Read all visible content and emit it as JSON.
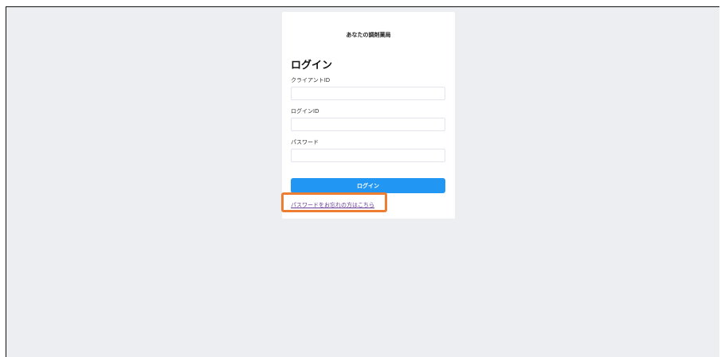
{
  "app": {
    "brand_name": "あなたの調剤薬局"
  },
  "login_form": {
    "title": "ログイン",
    "client_id_label": "クライアントID",
    "client_id_value": "",
    "login_id_label": "ログインID",
    "login_id_value": "",
    "password_label": "パスワード",
    "password_value": "",
    "submit_label": "ログイン",
    "forgot_password_link": "パスワードをお忘れの方はこちら"
  },
  "colors": {
    "background": "#edeef2",
    "card": "#ffffff",
    "primary_button": "#2196f3",
    "link": "#6a3d9a",
    "highlight_annotation": "#ed7d31"
  }
}
